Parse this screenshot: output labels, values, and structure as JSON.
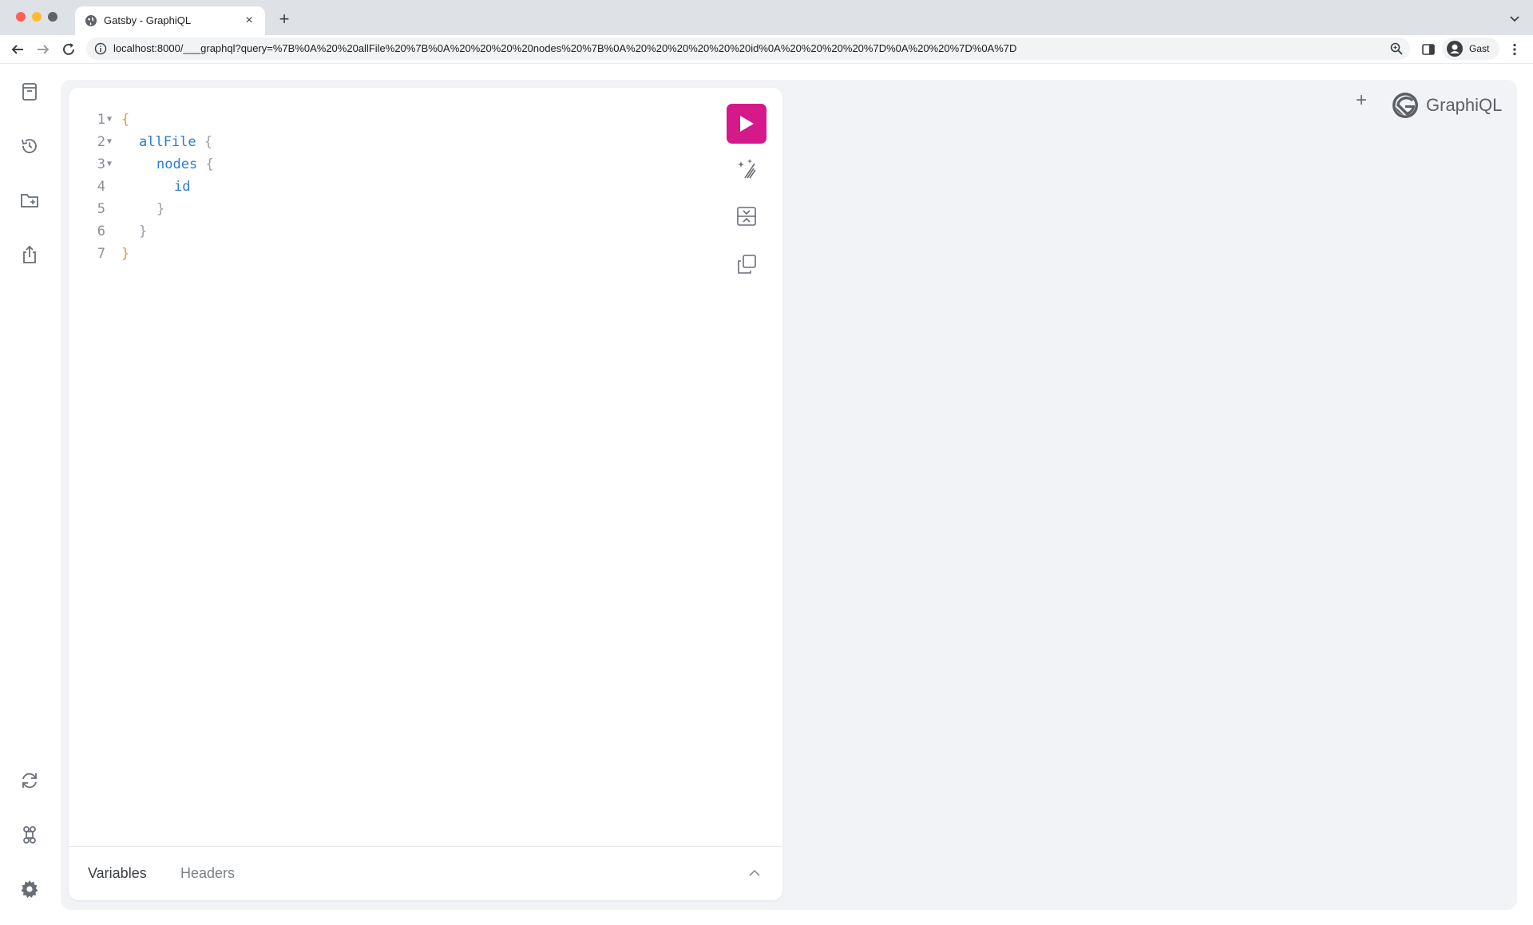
{
  "browser": {
    "tab_title": "Gatsby - GraphiQL",
    "url": "localhost:8000/___graphql?query=%7B%0A%20%20allFile%20%7B%0A%20%20%20%20nodes%20%7B%0A%20%20%20%20%20%20id%0A%20%20%20%20%7D%0A%20%20%7D%0A%7D",
    "profile_name": "Gast",
    "traffic_colors": [
      "#fe5f57",
      "#febc2e",
      "#5f6368"
    ]
  },
  "sidebar": {
    "top_icons": [
      "docs-icon",
      "history-icon",
      "explorer-icon",
      "export-icon"
    ],
    "bottom_icons": [
      "refetch-schema-icon",
      "keyboard-shortcuts-icon",
      "settings-icon"
    ]
  },
  "editor": {
    "lines": [
      {
        "number": "1",
        "text": "{"
      },
      {
        "number": "2",
        "text": "allFile"
      },
      {
        "number": "3",
        "text": "nodes"
      },
      {
        "number": "4",
        "text": "id"
      },
      {
        "number": "5",
        "text": "}"
      },
      {
        "number": "6",
        "text": "}"
      },
      {
        "number": "7",
        "text": "}"
      }
    ],
    "open_brace": "{",
    "bottom_tabs": {
      "variables": "Variables",
      "headers": "Headers"
    },
    "accent_color": "#d5198b"
  },
  "header": {
    "logo_text": "GraphiQL"
  }
}
